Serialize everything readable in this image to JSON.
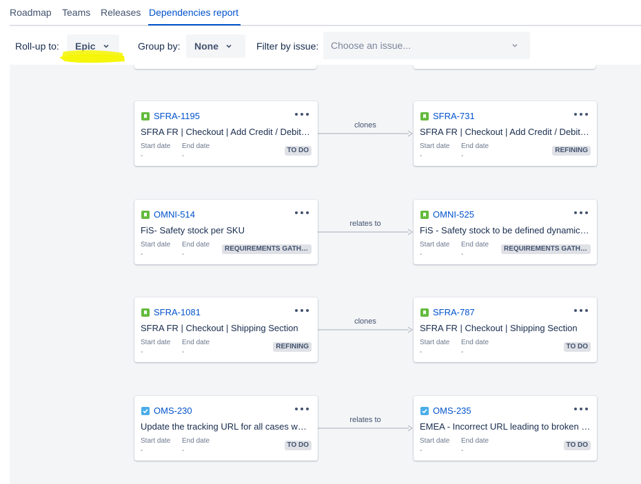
{
  "tabs": [
    {
      "label": "Roadmap"
    },
    {
      "label": "Teams"
    },
    {
      "label": "Releases"
    },
    {
      "label": "Dependencies report",
      "active": true
    }
  ],
  "toolbar": {
    "rollup_label": "Roll-up to:",
    "rollup_value": "Epic",
    "groupby_label": "Group by:",
    "groupby_value": "None",
    "filter_label": "Filter by issue:",
    "filter_placeholder": "Choose an issue..."
  },
  "card_labels": {
    "start": "Start date",
    "end": "End date",
    "empty": "-"
  },
  "colors": {
    "accent": "#0052cc",
    "story": "#63ba3c",
    "task": "#4bade8",
    "highlight": "#f5f500"
  },
  "dependencies": [
    {
      "link": "clones",
      "from": {
        "key": "SFRA-1195",
        "type": "story",
        "summary": "SFRA FR | Checkout | Add Credit / Debit C...",
        "status": "TO DO"
      },
      "to": {
        "key": "SFRA-731",
        "type": "story",
        "summary": "SFRA FR | Checkout | Add Credit / Debit C...",
        "status": "REFINING"
      }
    },
    {
      "link": "relates to",
      "from": {
        "key": "OMNI-514",
        "type": "story",
        "summary": "FiS- Safety stock per SKU",
        "status": "REQUIREMENTS GATHE..."
      },
      "to": {
        "key": "OMNI-525",
        "type": "story",
        "summary": "FiS - Safety stock to be defined dynamicall...",
        "status": "REQUIREMENTS GATHE..."
      }
    },
    {
      "link": "clones",
      "from": {
        "key": "SFRA-1081",
        "type": "story",
        "summary": "SFRA FR | Checkout | Shipping Section",
        "status": "REFINING"
      },
      "to": {
        "key": "SFRA-787",
        "type": "story",
        "summary": "SFRA FR | Checkout | Shipping Section",
        "status": "TO DO"
      }
    },
    {
      "link": "relates to",
      "from": {
        "key": "OMS-230",
        "type": "task",
        "summary": "Update the tracking URL for all cases wher...",
        "status": "TO DO"
      },
      "to": {
        "key": "OMS-235",
        "type": "task",
        "summary": "EMEA - Incorrect URL leading to broken N...",
        "status": "TO DO"
      }
    }
  ]
}
